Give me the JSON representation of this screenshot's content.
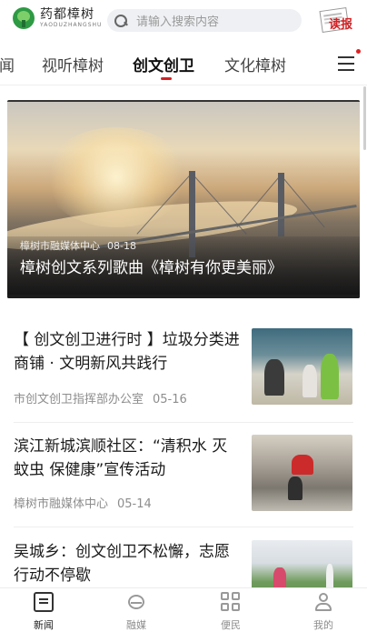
{
  "header": {
    "logo": {
      "title": "药都樟树",
      "subtitle": "YAODUZHANGSHU"
    },
    "search": {
      "placeholder": "请输入搜索内容"
    },
    "read_label": "读报"
  },
  "tabs": [
    {
      "label": "闻"
    },
    {
      "label": "视听樟树"
    },
    {
      "label": "创文创卫",
      "active": true
    },
    {
      "label": "文化樟树"
    }
  ],
  "banner": {
    "source": "樟树市融媒体中心",
    "date": "08-18",
    "title": "樟树创文系列歌曲《樟树有你更美丽》"
  },
  "news": [
    {
      "title": "【 创文创卫进行时 】垃圾分类进商铺 · 文明新风共践行",
      "source": "市创文创卫指挥部办公室",
      "date": "05-16"
    },
    {
      "title": "滨江新城滨顺社区：“清积水 灭蚊虫 保健康”宣传活动",
      "source": "樟树市融媒体中心",
      "date": "05-14"
    },
    {
      "title": "吴城乡：创文创卫不松懈，志愿行动不停歇",
      "source": "",
      "date": ""
    }
  ],
  "bottom_nav": [
    {
      "label": "新闻",
      "icon": "news-icon",
      "active": true
    },
    {
      "label": "融媒",
      "icon": "cloud-icon"
    },
    {
      "label": "便民",
      "icon": "grid-icon"
    },
    {
      "label": "我的",
      "icon": "user-icon"
    }
  ],
  "colors": {
    "accent": "#d32124",
    "brand_green": "#2e9a44"
  }
}
